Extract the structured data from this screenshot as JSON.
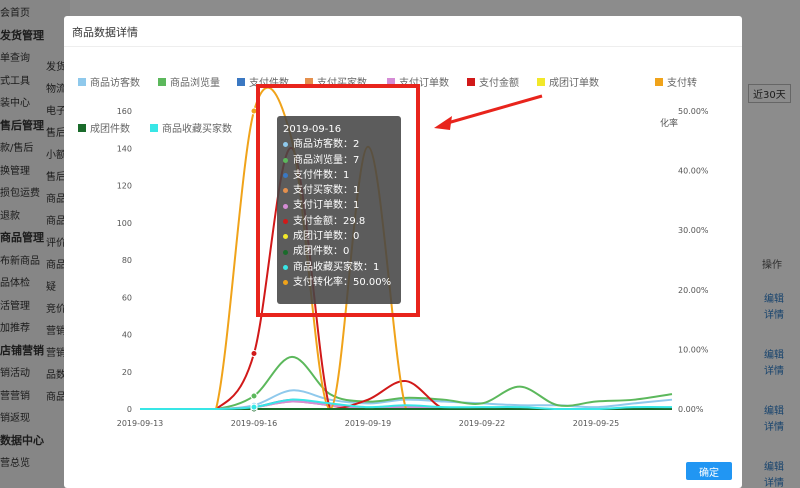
{
  "background": {
    "sidebar": [
      {
        "text": "会首页",
        "group": false
      },
      {
        "text": "发货管理",
        "group": true
      },
      {
        "text": "单查询",
        "group": false
      },
      {
        "text": "式工具",
        "group": false
      },
      {
        "text": "装中心",
        "group": false
      },
      {
        "text": "售后管理",
        "group": true
      },
      {
        "text": "款/售后",
        "group": false
      },
      {
        "text": "换管理",
        "group": false
      },
      {
        "text": "损包运费",
        "group": false
      },
      {
        "text": "退款",
        "group": false
      },
      {
        "text": "商品管理",
        "group": true
      },
      {
        "text": "布新商品",
        "group": false
      },
      {
        "text": "品体检",
        "group": false
      },
      {
        "text": "活管理",
        "group": false
      },
      {
        "text": "加推荐",
        "group": false
      },
      {
        "text": "店铺营销",
        "group": true
      },
      {
        "text": "销活动",
        "group": false
      },
      {
        "text": "营营销",
        "group": false
      },
      {
        "text": "销返现",
        "group": false
      },
      {
        "text": "数据中心",
        "group": true
      },
      {
        "text": "营总览",
        "group": false
      }
    ],
    "col2": [
      "发货",
      "物流",
      "电子",
      "售后",
      "小额",
      "售后",
      "商品",
      "商品",
      "评价",
      "商品",
      "疑",
      "竞价",
      "营销",
      "营销",
      "品数",
      "商品"
    ],
    "right_button": "近30天",
    "right_header": "操作",
    "right_links": [
      "编辑",
      "详情",
      "编辑",
      "详情",
      "编辑",
      "详情",
      "编辑",
      "详情"
    ]
  },
  "modal": {
    "title": "商品数据详情",
    "confirm_label": "确定"
  },
  "colors": {
    "visitors": "#8fc9ec",
    "views": "#5cb85c",
    "pay_items": "#3b78c2",
    "pay_buyers": "#e5904d",
    "pay_orders": "#d58cd5",
    "pay_amount": "#d11919",
    "group_orders": "#f2e82a",
    "conv_rate": "#f0a31a",
    "group_items": "#1a6b2b",
    "fav_buyers": "#38e6e6",
    "highlight": "#e8241c"
  },
  "chart_data": {
    "type": "line",
    "x": [
      "2019-09-13",
      "2019-09-14",
      "2019-09-15",
      "2019-09-16",
      "2019-09-17",
      "2019-09-18",
      "2019-09-19",
      "2019-09-20",
      "2019-09-21",
      "2019-09-22",
      "2019-09-23",
      "2019-09-24",
      "2019-09-25",
      "2019-09-26",
      "2019-09-27"
    ],
    "x_tick_labels": [
      "2019-09-13",
      "2019-09-16",
      "2019-09-19",
      "2019-09-22",
      "2019-09-25"
    ],
    "y_left_ticks": [
      "0",
      "20",
      "40",
      "60",
      "80",
      "100",
      "120",
      "140",
      "160"
    ],
    "y_right_ticks": [
      "0.00%",
      "10.00%",
      "20.00%",
      "30.00%",
      "40.00%",
      "50.00%"
    ],
    "y_right_label": "化率",
    "ylim_left": [
      0,
      160
    ],
    "ylim_right": [
      0,
      50
    ],
    "legend_placement": "top",
    "series": [
      {
        "name": "商品访客数",
        "color_key": "visitors",
        "axis": "left",
        "values": [
          0,
          0,
          0,
          2,
          10,
          5,
          3,
          5,
          4,
          3,
          2,
          2,
          1,
          3,
          5
        ]
      },
      {
        "name": "商品浏览量",
        "color_key": "views",
        "axis": "left",
        "values": [
          0,
          0,
          0,
          7,
          28,
          8,
          4,
          6,
          5,
          3,
          12,
          2,
          4,
          5,
          8
        ]
      },
      {
        "name": "支付件数",
        "color_key": "pay_items",
        "axis": "left",
        "values": [
          0,
          0,
          0,
          1,
          5,
          2,
          0,
          1,
          0,
          0,
          0,
          0,
          0,
          0,
          0
        ]
      },
      {
        "name": "支付买家数",
        "color_key": "pay_buyers",
        "axis": "left",
        "values": [
          0,
          0,
          0,
          1,
          4,
          2,
          0,
          1,
          0,
          0,
          0,
          0,
          0,
          0,
          0
        ]
      },
      {
        "name": "支付订单数",
        "color_key": "pay_orders",
        "axis": "left",
        "values": [
          0,
          0,
          0,
          1,
          4,
          2,
          0,
          1,
          0,
          0,
          0,
          0,
          0,
          0,
          0
        ]
      },
      {
        "name": "支付金额",
        "color_key": "pay_amount",
        "axis": "left",
        "values": [
          0,
          0,
          0,
          29.8,
          140,
          0,
          5,
          15,
          0,
          0,
          0,
          0,
          0,
          0,
          0
        ]
      },
      {
        "name": "成团订单数",
        "color_key": "group_orders",
        "axis": "left",
        "values": [
          0,
          0,
          0,
          0,
          0,
          0,
          0,
          0,
          0,
          0,
          0,
          0,
          0,
          0,
          0
        ]
      },
      {
        "name": "支付转化率",
        "color_key": "conv_rate",
        "axis": "right",
        "values": [
          0,
          0,
          0,
          50,
          45,
          0,
          44,
          0,
          0,
          0,
          0,
          0,
          0,
          0,
          0
        ]
      },
      {
        "name": "成团件数",
        "color_key": "group_items",
        "axis": "left",
        "values": [
          0,
          0,
          0,
          0,
          0,
          0,
          0,
          0,
          0,
          0,
          0,
          0,
          0,
          0,
          0
        ]
      },
      {
        "name": "商品收藏买家数",
        "color_key": "fav_buyers",
        "axis": "left",
        "values": [
          0,
          0,
          0,
          1,
          5,
          3,
          1,
          2,
          1,
          1,
          1,
          0,
          0,
          1,
          1
        ]
      }
    ],
    "legend_labels": [
      "商品访客数",
      "商品浏览量",
      "支付件数",
      "支付买家数",
      "支付订单数",
      "支付金额",
      "成团订单数",
      "支付转",
      "成团件数",
      "商品收藏买家数"
    ]
  },
  "tooltip": {
    "date": "2019-09-16",
    "rows": [
      {
        "label": "商品访客数：",
        "value": "2",
        "color_key": "visitors"
      },
      {
        "label": "商品浏览量：",
        "value": "7",
        "color_key": "views"
      },
      {
        "label": "支付件数：",
        "value": "1",
        "color_key": "pay_items"
      },
      {
        "label": "支付买家数：",
        "value": "1",
        "color_key": "pay_buyers"
      },
      {
        "label": "支付订单数：",
        "value": "1",
        "color_key": "pay_orders"
      },
      {
        "label": "支付金额：",
        "value": "29.8",
        "color_key": "pay_amount"
      },
      {
        "label": "成团订单数：",
        "value": "0",
        "color_key": "group_orders"
      },
      {
        "label": "成团件数：",
        "value": "0",
        "color_key": "group_items"
      },
      {
        "label": "商品收藏买家数：",
        "value": "1",
        "color_key": "fav_buyers"
      },
      {
        "label": "支付转化率：",
        "value": "50.00%",
        "color_key": "conv_rate"
      }
    ]
  }
}
